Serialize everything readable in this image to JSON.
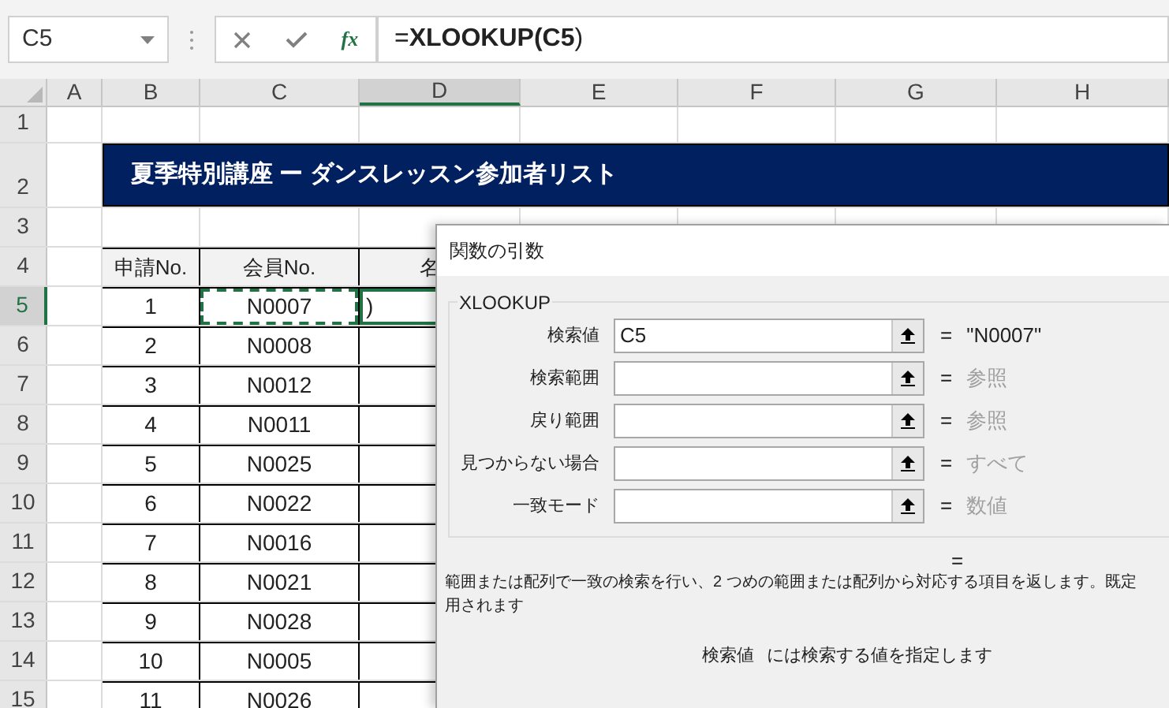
{
  "name_box": {
    "value": "C5"
  },
  "formula_bar": {
    "function_button": "fx",
    "formula": "=**XLOOKUP(C5**)"
  },
  "columns": [
    {
      "label": "A",
      "selected": false
    },
    {
      "label": "B",
      "selected": false
    },
    {
      "label": "C",
      "selected": false
    },
    {
      "label": "D",
      "selected": true
    },
    {
      "label": "E",
      "selected": false
    },
    {
      "label": "F",
      "selected": false
    },
    {
      "label": "G",
      "selected": false
    },
    {
      "label": "H",
      "selected": false
    }
  ],
  "row_numbers": [
    {
      "label": "1",
      "selected": false
    },
    {
      "label": "2",
      "selected": false
    },
    {
      "label": "3",
      "selected": false
    },
    {
      "label": "4",
      "selected": false
    },
    {
      "label": "5",
      "selected": true
    },
    {
      "label": "6",
      "selected": false
    },
    {
      "label": "7",
      "selected": false
    },
    {
      "label": "8",
      "selected": false
    },
    {
      "label": "9",
      "selected": false
    },
    {
      "label": "10",
      "selected": false
    },
    {
      "label": "11",
      "selected": false
    },
    {
      "label": "12",
      "selected": false
    },
    {
      "label": "13",
      "selected": false
    },
    {
      "label": "14",
      "selected": false
    },
    {
      "label": "15",
      "selected": false
    }
  ],
  "sheet_title": "夏季特別講座 ー ダンスレッスン参加者リスト",
  "table": {
    "columns": [
      "申請No.",
      "会員No.",
      "名"
    ],
    "rows": [
      {
        "cells": [
          "1",
          "N0007",
          ")"
        ]
      },
      {
        "cells": [
          "2",
          "N0008",
          ""
        ]
      },
      {
        "cells": [
          "3",
          "N0012",
          ""
        ]
      },
      {
        "cells": [
          "4",
          "N0011",
          ""
        ]
      },
      {
        "cells": [
          "5",
          "N0025",
          ""
        ]
      },
      {
        "cells": [
          "6",
          "N0022",
          ""
        ]
      },
      {
        "cells": [
          "7",
          "N0016",
          ""
        ]
      },
      {
        "cells": [
          "8",
          "N0021",
          ""
        ]
      },
      {
        "cells": [
          "9",
          "N0028",
          ""
        ]
      },
      {
        "cells": [
          "10",
          "N0005",
          ""
        ]
      },
      {
        "cells": [
          "11",
          "N0026",
          ""
        ]
      }
    ]
  },
  "dialog": {
    "title": "関数の引数",
    "group": "XLOOKUP",
    "arguments": [
      {
        "label": "検索値",
        "value": "C5",
        "equals": "=",
        "result": "\"N0007\"",
        "dimmed": false
      },
      {
        "label": "検索範囲",
        "equals": "=",
        "result": "参照",
        "dimmed": true
      },
      {
        "label": "戻り範囲",
        "equals": "=",
        "result": "参照",
        "dimmed": true
      },
      {
        "label": "見つからない場合",
        "equals": "=",
        "result": "すべて",
        "dimmed": true
      },
      {
        "label": "一致モード",
        "equals": "=",
        "result": "数値",
        "dimmed": true
      }
    ],
    "formula_result": "=",
    "description_lines": [
      "範囲または配列で一致の検索を行い、2 つめの範囲または配列から対応する項目を返します。既定",
      "用されます"
    ],
    "argument_name": "検索値",
    "argument_help": "には検索する値を指定します"
  }
}
